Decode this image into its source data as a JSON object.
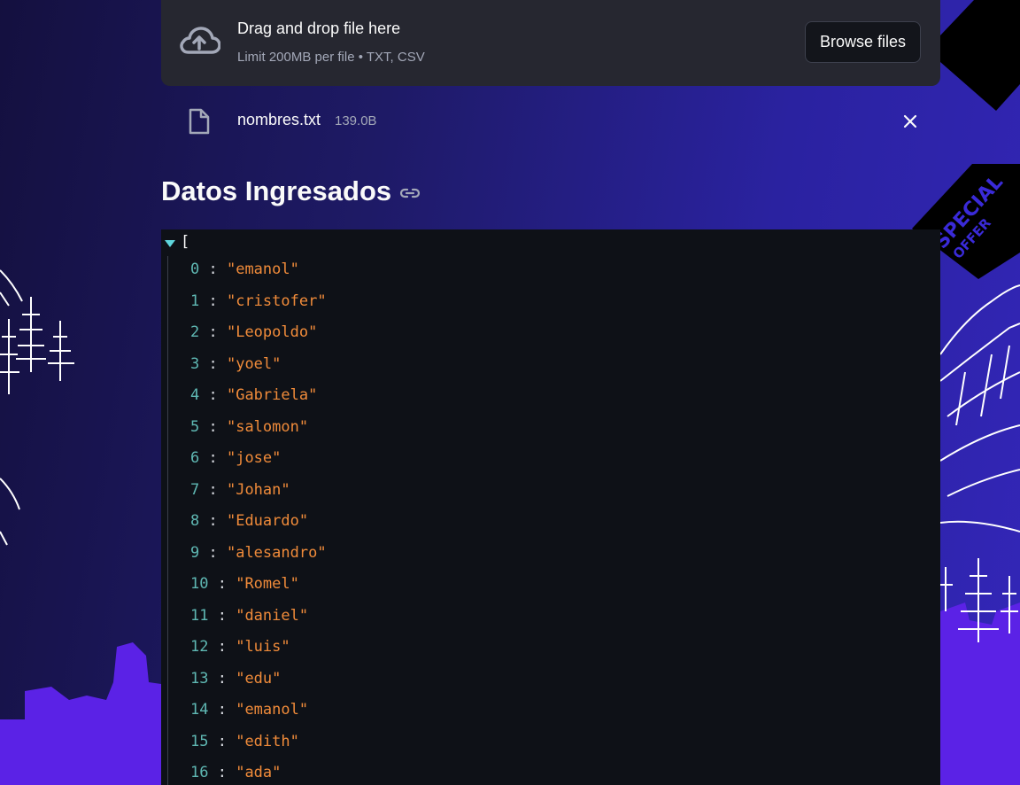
{
  "uploader": {
    "title": "Drag and drop file here",
    "limit": "Limit 200MB per file • TXT, CSV",
    "browse_label": "Browse files",
    "icon": "cloud-upload-icon"
  },
  "file": {
    "name": "nombres.txt",
    "size": "139.0B",
    "icon": "file-icon",
    "remove_icon": "close-icon"
  },
  "heading": {
    "text": "Datos Ingresados",
    "icon": "link-icon"
  },
  "json_viewer": {
    "open_bracket": "[",
    "items": [
      {
        "index": "0",
        "value": "\"emanol\""
      },
      {
        "index": "1",
        "value": "\"cristofer\""
      },
      {
        "index": "2",
        "value": "\"Leopoldo\""
      },
      {
        "index": "3",
        "value": "\"yoel\""
      },
      {
        "index": "4",
        "value": "\"Gabriela\""
      },
      {
        "index": "5",
        "value": "\"salomon\""
      },
      {
        "index": "6",
        "value": "\"jose\""
      },
      {
        "index": "7",
        "value": "\"Johan\""
      },
      {
        "index": "8",
        "value": "\"Eduardo\""
      },
      {
        "index": "9",
        "value": "\"alesandro\""
      },
      {
        "index": "10",
        "value": "\"Romel\""
      },
      {
        "index": "11",
        "value": "\"daniel\""
      },
      {
        "index": "12",
        "value": "\"luis\""
      },
      {
        "index": "13",
        "value": "\"edu\""
      },
      {
        "index": "14",
        "value": "\"emanol\""
      },
      {
        "index": "15",
        "value": "\"edith\""
      },
      {
        "index": "16",
        "value": "\"ada\""
      }
    ]
  },
  "background": {
    "tag_text_line1": "SPECIAL",
    "tag_text_line2": "OFFER"
  },
  "colors": {
    "panel": "#262730",
    "json_bg": "#0e1117",
    "index_color": "#5fb8b3",
    "string_color": "#f08b3a"
  }
}
